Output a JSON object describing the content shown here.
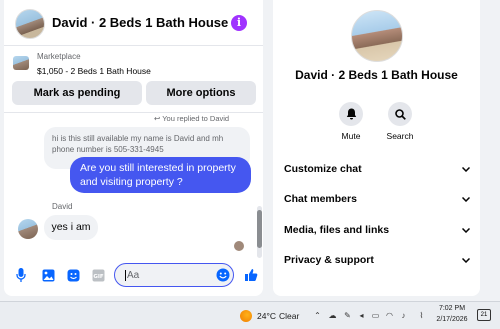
{
  "chat": {
    "header": {
      "title": "David · 2 Beds 1 Bath House",
      "info_icon": "info-icon"
    },
    "marketplace": {
      "source": "Marketplace",
      "listing": "$1,050 - 2 Beds 1 Bath House",
      "pending_label": "Mark as pending",
      "options_label": "More options"
    },
    "messages": {
      "replied_note": "You replied to David",
      "quoted": "hi is this still available my name is David and mh phone number is 505-331-4945",
      "sent": "Are you still interested in property and visiting property ?",
      "sender": "David",
      "received": "yes i am"
    },
    "composer": {
      "placeholder": "Aa"
    }
  },
  "info_panel": {
    "title": "David · 2 Beds 1 Bath House",
    "actions": [
      {
        "label": "Mute",
        "icon": "bell-icon"
      },
      {
        "label": "Search",
        "icon": "search-icon"
      }
    ],
    "sections": [
      {
        "label": "Customize chat"
      },
      {
        "label": "Chat members"
      },
      {
        "label": "Media, files and links"
      },
      {
        "label": "Privacy & support"
      }
    ]
  },
  "taskbar": {
    "temperature": "24°C",
    "condition": "Clear",
    "time": "7:02 PM",
    "date": "2/17/2026",
    "notification_count": "21"
  },
  "colors": {
    "accent": "#4557f0",
    "info": "#a033ff",
    "bg": "#f0f2f5"
  }
}
